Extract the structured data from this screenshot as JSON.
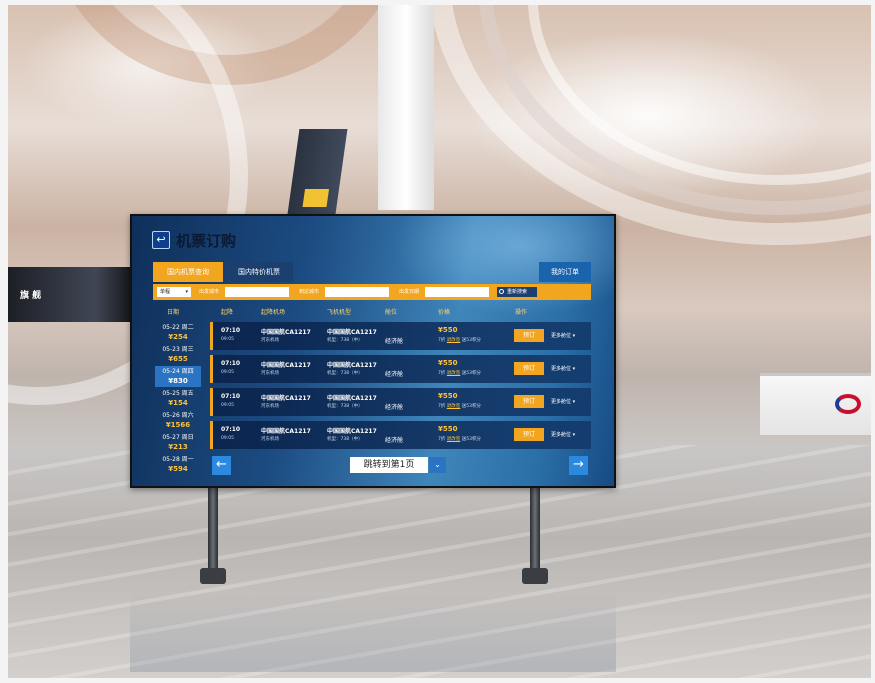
{
  "background": {
    "left_sign_text": "旗 舰"
  },
  "app": {
    "back_icon": "↩",
    "title": "机票订购"
  },
  "tabs": {
    "domestic_query": "国内机票查询",
    "domestic_special": "国内特价机票",
    "my_orders": "我的订单"
  },
  "search": {
    "trip_type": "单程",
    "depart_city_label": "出发城市",
    "arrive_city_label": "到达城市",
    "depart_date_label": "出发日期",
    "search_button": "重新搜索"
  },
  "table_headers": [
    "日期",
    "起降",
    "起降机场",
    "飞机机型",
    "舱位",
    "价格",
    "操作"
  ],
  "dates": [
    {
      "date": "05-22 周二",
      "price": "¥254"
    },
    {
      "date": "05-23 周三",
      "price": "¥655"
    },
    {
      "date": "05-24 周四",
      "price": "¥830"
    },
    {
      "date": "05-25 周五",
      "price": "¥154"
    },
    {
      "date": "05-26 周六",
      "price": "¥1566"
    },
    {
      "date": "05-27 周日",
      "price": "¥213"
    },
    {
      "date": "05-28 周一",
      "price": "¥594"
    }
  ],
  "flights": [
    {
      "time": "07:10",
      "time2": "09:05",
      "airline": "中国国航CA1217",
      "airport": "河东机场",
      "flight": "中国国航CA1217",
      "model": "机型：738（中）",
      "cabin": "经济舱",
      "price": "¥550",
      "refund_prefix": "7折",
      "refund_link": "退改签",
      "refund_suffix": "送53积分",
      "book": "预订",
      "more": "更多舱位"
    },
    {
      "time": "07:10",
      "time2": "09:05",
      "airline": "中国国航CA1217",
      "airport": "河东机场",
      "flight": "中国国航CA1217",
      "model": "机型：738（中）",
      "cabin": "经济舱",
      "price": "¥550",
      "refund_prefix": "7折",
      "refund_link": "退改签",
      "refund_suffix": "送53积分",
      "book": "预订",
      "more": "更多舱位"
    },
    {
      "time": "07:10",
      "time2": "09:05",
      "airline": "中国国航CA1217",
      "airport": "河东机场",
      "flight": "中国国航CA1217",
      "model": "机型：738（中）",
      "cabin": "经济舱",
      "price": "¥550",
      "refund_prefix": "7折",
      "refund_link": "退改签",
      "refund_suffix": "送53积分",
      "book": "预订",
      "more": "更多舱位"
    },
    {
      "time": "07:10",
      "time2": "09:05",
      "airline": "中国国航CA1217",
      "airport": "河东机场",
      "flight": "中国国航CA1217",
      "model": "机型：738（中）",
      "cabin": "经济舱",
      "price": "¥550",
      "refund_prefix": "7折",
      "refund_link": "退改签",
      "refund_suffix": "送53积分",
      "book": "预订",
      "more": "更多舱位"
    }
  ],
  "pager": {
    "prev_icon": "←",
    "next_icon": "→",
    "jump_label": "跳转到第1页",
    "dropdown_icon": "⌄"
  },
  "colors": {
    "accent_orange": "#f2a51e",
    "navy": "#1b3f6e",
    "selected_blue": "#2b74c4"
  }
}
